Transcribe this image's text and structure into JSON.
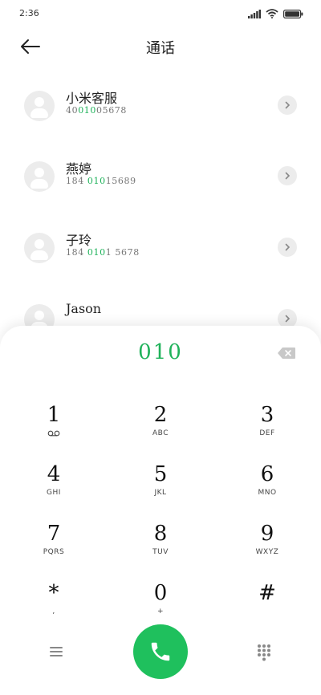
{
  "status_bar": {
    "time": "2:36"
  },
  "header": {
    "title": "通话"
  },
  "contacts": [
    {
      "name": "小米客服",
      "number_prefix": "40",
      "number_match": "010",
      "number_suffix": "05678"
    },
    {
      "name": "燕婷",
      "number_prefix": "184 ",
      "number_match": "010",
      "number_suffix": "15689"
    },
    {
      "name": "子玲",
      "number_prefix": "184 ",
      "number_match": "010",
      "number_suffix": "1 5678"
    },
    {
      "name": "Jason",
      "number_prefix": "",
      "number_match": "",
      "number_suffix": ""
    }
  ],
  "dialpad": {
    "input": "010",
    "keys": [
      {
        "digit": "1",
        "letters": "",
        "icon": "voicemail-icon"
      },
      {
        "digit": "2",
        "letters": "ABC"
      },
      {
        "digit": "3",
        "letters": "DEF"
      },
      {
        "digit": "4",
        "letters": "GHI"
      },
      {
        "digit": "5",
        "letters": "JKL"
      },
      {
        "digit": "6",
        "letters": "MNO"
      },
      {
        "digit": "7",
        "letters": "PQRS"
      },
      {
        "digit": "8",
        "letters": "TUV"
      },
      {
        "digit": "9",
        "letters": "WXYZ"
      },
      {
        "digit": "*",
        "letters": ","
      },
      {
        "digit": "0",
        "letters": "+"
      },
      {
        "digit": "#",
        "letters": ""
      }
    ]
  },
  "colors": {
    "accent": "#1fb25a",
    "call_button": "#1fc05d"
  }
}
